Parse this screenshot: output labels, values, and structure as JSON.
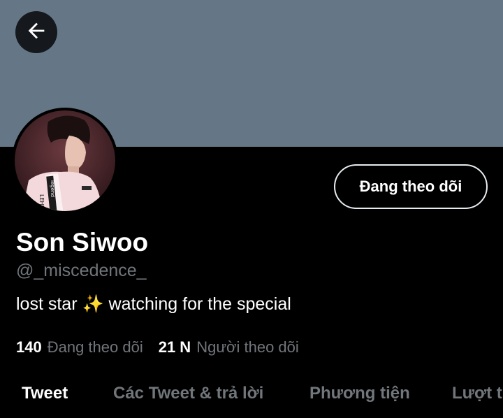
{
  "header": {
    "back_icon": "arrow-left-icon"
  },
  "profile": {
    "display_name": "Son Siwoo",
    "handle": "@_miscedence_",
    "bio": "lost star ✨ watching for the special",
    "follow_button_label": "Đang theo dõi",
    "avatar_text_1": "LEHENDS",
    "avatar_text_2": "legend"
  },
  "stats": {
    "following_count": "140",
    "following_label": "Đang theo dõi",
    "followers_count": "21 N",
    "followers_label": "Người theo dõi"
  },
  "tabs": [
    {
      "label": "Tweet"
    },
    {
      "label": "Các Tweet & trả lời"
    },
    {
      "label": "Phương tiện"
    },
    {
      "label": "Lượt thích"
    }
  ],
  "colors": {
    "banner": "#657786",
    "background": "#000000",
    "muted_text": "#71767b",
    "primary_text": "#ffffff"
  }
}
